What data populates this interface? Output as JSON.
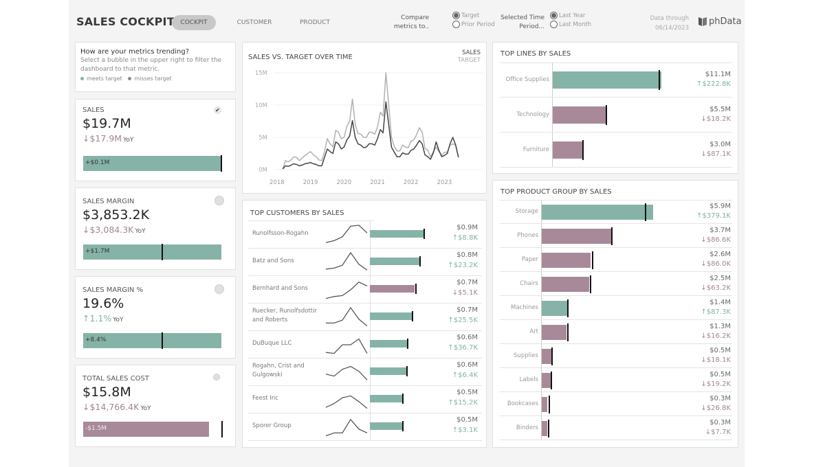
{
  "app": {
    "title": "SALES COCKPIT",
    "tabs": [
      {
        "label": "COCKPIT",
        "active": true
      },
      {
        "label": "CUSTOMER",
        "active": false
      },
      {
        "label": "PRODUCT",
        "active": false
      }
    ],
    "compare": {
      "label_line1": "Compare",
      "label_line2": "metrics to..",
      "options": [
        {
          "label": "Target",
          "selected": true
        },
        {
          "label": "Prior Period",
          "selected": false
        }
      ]
    },
    "period": {
      "label_line1": "Selected Time",
      "label_line2": "Period...",
      "options": [
        {
          "label": "Last Year",
          "selected": true
        },
        {
          "label": "Last Month",
          "selected": false
        }
      ]
    },
    "data_through_label": "Data through",
    "data_through_date": "06/14/2023",
    "logo_text": "phData"
  },
  "colors": {
    "meets": "#86b3a8",
    "misses": "#a8899a",
    "sales_line": "#444444",
    "target_line": "#b0b0b0"
  },
  "info": {
    "title": "How are your metrics trending?",
    "text_line1": "Select a bubble in the upper right to filter the",
    "text_line2": "dashboard to that metric.",
    "legend_meets": "meets target",
    "legend_misses": "misses target"
  },
  "kpis": [
    {
      "name": "SALES",
      "value": "$19.7M",
      "yoy_arrow": "↓",
      "yoy_value": "$17.9M",
      "yoy_suffix": "YoY",
      "yoy_dir": "down",
      "bar_label": "+$0.1M",
      "status": "meets",
      "selected": true,
      "bar_pct": 100,
      "target_pct": 100
    },
    {
      "name": "SALES MARGIN",
      "value": "$3,853.2K",
      "yoy_arrow": "↓",
      "yoy_value": "$3,084.3K",
      "yoy_suffix": "YoY",
      "yoy_dir": "down",
      "bar_label": "+$1.7M",
      "status": "meets",
      "selected": false,
      "bar_pct": 100,
      "target_pct": 57
    },
    {
      "name": "SALES MARGIN %",
      "value": "19.6%",
      "yoy_arrow": "↑",
      "yoy_value": "1.1%",
      "yoy_suffix": "YoY",
      "yoy_dir": "up",
      "bar_label": "+8.4%",
      "status": "meets",
      "selected": false,
      "bar_pct": 100,
      "target_pct": 57
    },
    {
      "name": "TOTAL SALES COST",
      "value": "$15.8M",
      "yoy_arrow": "↓",
      "yoy_value": "$14,766.4K",
      "yoy_suffix": "YoY",
      "yoy_dir": "down",
      "bar_label": "-$1.5M",
      "status": "misses",
      "selected": false,
      "bar_pct": 91,
      "target_pct": 100
    }
  ],
  "chart_data": [
    {
      "type": "line",
      "title": "SALES VS. TARGET OVER TIME",
      "legend": [
        "SALES",
        "TARGET"
      ],
      "legend_placement": "top-right",
      "xlabel": "",
      "ylabel": "",
      "x_ticks": [
        "2018",
        "2019",
        "2020",
        "2021",
        "2022",
        "2023"
      ],
      "y_ticks": [
        "0M",
        "5M",
        "10M",
        "15M"
      ],
      "ylim": [
        0,
        15
      ],
      "x_start": 2018.17,
      "x_step_years": 0.0833,
      "series": [
        {
          "name": "SALES",
          "values": [
            0.1,
            0.6,
            0.5,
            0.7,
            0.9,
            0.8,
            0.6,
            0.7,
            0.9,
            1.0,
            1.1,
            0.9,
            0.8,
            0.6,
            0.6,
            1.9,
            3.2,
            2.8,
            2.5,
            4.3,
            4.0,
            3.2,
            3.5,
            4.6,
            5.2,
            7.6,
            5.0,
            4.0,
            3.8,
            3.4,
            3.5,
            4.0,
            4.0,
            3.8,
            4.8,
            6.2,
            5.7,
            10.5,
            7.0,
            3.5,
            2.7,
            2.0,
            2.0,
            2.6,
            2.4,
            2.4,
            3.0,
            3.2,
            3.8,
            4.5,
            4.0,
            2.3,
            2.0,
            1.6,
            2.6,
            4.3,
            3.0,
            2.0,
            2.2,
            2.5,
            4.0,
            5.0,
            3.8,
            1.9
          ]
        },
        {
          "name": "TARGET",
          "values": [
            0.1,
            1.4,
            1.2,
            1.5,
            2.0,
            1.9,
            1.4,
            1.8,
            2.2,
            2.5,
            2.8,
            2.3,
            2.0,
            1.5,
            1.4,
            2.8,
            4.8,
            4.0,
            3.5,
            6.1,
            5.8,
            4.8,
            5.0,
            6.7,
            7.5,
            10.9,
            7.0,
            5.6,
            5.5,
            5.0,
            5.0,
            5.8,
            5.8,
            5.5,
            6.6,
            8.9,
            8.3,
            15.0,
            10.0,
            5.0,
            3.6,
            2.9,
            2.9,
            3.8,
            3.5,
            3.4,
            4.4,
            4.6,
            5.4,
            6.5,
            5.8,
            3.3,
            3.0,
            2.0,
            2.8,
            3.5,
            2.8,
            2.2,
            2.7,
            2.7,
            3.8,
            4.0,
            3.8,
            1.9
          ]
        }
      ]
    },
    {
      "type": "bar",
      "title": "TOP CUSTOMERS BY SALES",
      "categories": [
        "Runolfsson-Rogahn",
        "Batz and Sons",
        "Bernhard and Sons",
        "Ruecker, Runolfsdottir and Roberts",
        "DuBuque LLC",
        "Rogahn, Crist and Gulgowski",
        "Feest Inc",
        "Sporer Group"
      ],
      "values": [
        0.9,
        0.8,
        0.7,
        0.7,
        0.6,
        0.6,
        0.5,
        0.5
      ],
      "value_labels": [
        "$0.9M",
        "$0.8M",
        "$0.7M",
        "$0.7M",
        "$0.6M",
        "$0.6M",
        "$0.5M",
        "$0.5M"
      ],
      "delta_arrows": [
        "↑",
        "↑",
        "↓",
        "↑",
        "↑",
        "↑",
        "↑",
        "↑"
      ],
      "delta_labels": [
        "$8.8K",
        "$23.2K",
        "$5.1K",
        "$25.5K",
        "$36.7K",
        "$6.4K",
        "$15.2K",
        "$3.1K"
      ],
      "status": [
        "meets",
        "meets",
        "misses",
        "meets",
        "meets",
        "meets",
        "meets",
        "meets"
      ],
      "bar_values": [
        0.92,
        0.85,
        0.77,
        0.72,
        0.64,
        0.62,
        0.55,
        0.55
      ],
      "target_values": [
        0.93,
        0.86,
        0.79,
        0.73,
        0.65,
        0.63,
        0.56,
        0.56
      ],
      "sparklines": [
        [
          0.1,
          0.2,
          0.4,
          0.95,
          1.0,
          0.6
        ],
        [
          0.15,
          0.2,
          0.35,
          1.0,
          0.4,
          0.1
        ],
        [
          0.05,
          0.15,
          0.2,
          0.5,
          0.9,
          0.7
        ],
        [
          0.2,
          0.2,
          0.35,
          1.0,
          0.4,
          0.05
        ],
        [
          0.1,
          0.05,
          0.5,
          0.5,
          0.8,
          0.05
        ],
        [
          0.4,
          0.3,
          0.65,
          0.8,
          0.55,
          0.1
        ],
        [
          0.1,
          0.3,
          0.6,
          0.7,
          0.4,
          0.05
        ],
        [
          0.05,
          0.2,
          0.2,
          0.9,
          0.4,
          0.2
        ]
      ]
    },
    {
      "type": "bar",
      "title": "TOP LINES BY SALES",
      "categories": [
        "Office Supplies",
        "Technology",
        "Furniture"
      ],
      "values": [
        11.1,
        5.5,
        3.0
      ],
      "value_labels": [
        "$11.1M",
        "$5.5M",
        "$3.0M"
      ],
      "delta_arrows": [
        "↑",
        "↓",
        "↓"
      ],
      "delta_labels": [
        "$222.8K",
        "$18.2K",
        "$87.1K"
      ],
      "status": [
        "meets",
        "misses",
        "misses"
      ],
      "target_values": [
        10.9,
        5.5,
        3.1
      ]
    },
    {
      "type": "bar",
      "title": "TOP PRODUCT GROUP BY SALES",
      "categories": [
        "Storage",
        "Phones",
        "Paper",
        "Chairs",
        "Machines",
        "Art",
        "Supplies",
        "Labels",
        "Bookcases",
        "Binders"
      ],
      "values": [
        5.9,
        3.7,
        2.6,
        2.5,
        1.4,
        1.3,
        0.5,
        0.5,
        0.3,
        0.3
      ],
      "value_labels": [
        "$5.9M",
        "$3.7M",
        "$2.6M",
        "$2.5M",
        "$1.4M",
        "$1.3M",
        "$0.5M",
        "$0.5M",
        "$0.3M",
        "$0.3M"
      ],
      "delta_arrows": [
        "↑",
        "↓",
        "↓",
        "↓",
        "↑",
        "↓",
        "↓",
        "↓",
        "↓",
        "↓"
      ],
      "delta_labels": [
        "$379.1K",
        "$86.6K",
        "$86.0K",
        "$63.2K",
        "$87.3K",
        "$16.2K",
        "$18.1K",
        "$19.2K",
        "$26.8K",
        "$7.7K"
      ],
      "status": [
        "meets",
        "misses",
        "misses",
        "misses",
        "meets",
        "misses",
        "misses",
        "misses",
        "misses",
        "misses"
      ],
      "target_values": [
        5.5,
        3.7,
        2.7,
        2.6,
        1.4,
        1.4,
        0.55,
        0.5,
        0.4,
        0.35
      ]
    }
  ]
}
